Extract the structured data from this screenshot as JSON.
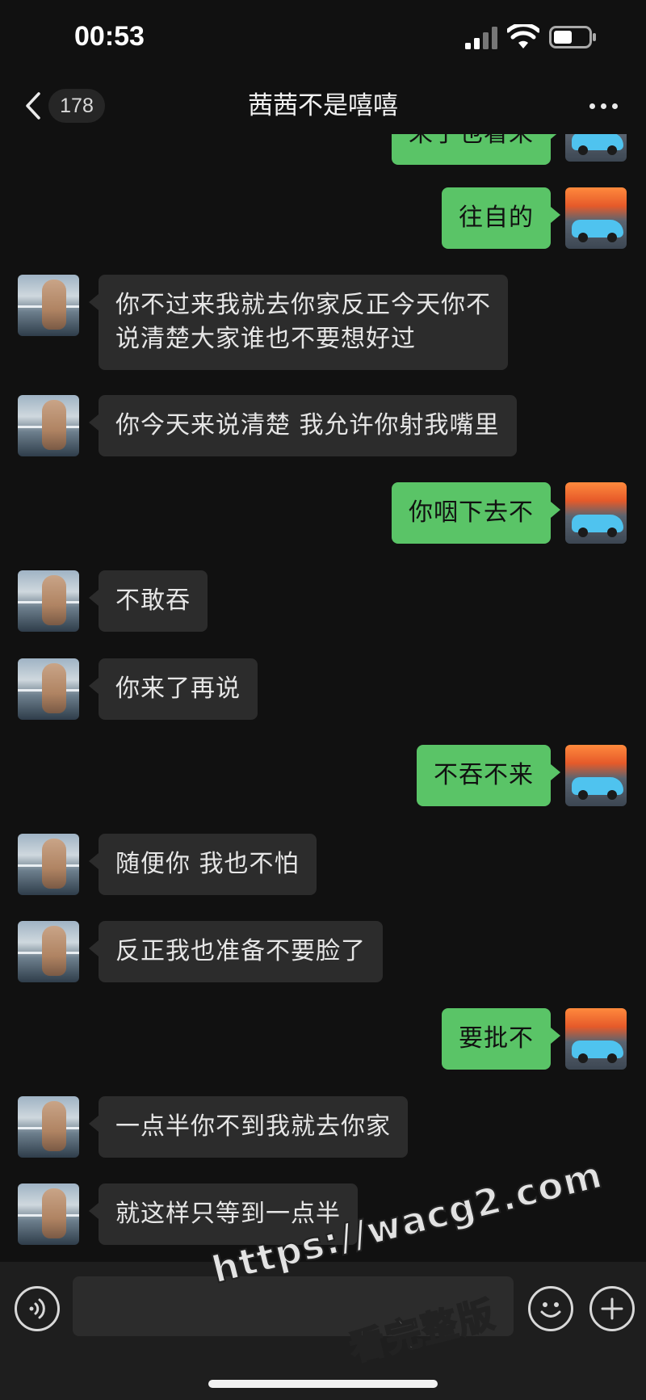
{
  "status_bar": {
    "time": "00:53"
  },
  "nav": {
    "unread_count": "178",
    "title": "茜茜不是嘻嘻"
  },
  "messages": [
    {
      "side": "out",
      "text": "来了也看来"
    },
    {
      "side": "out",
      "text": "往自的"
    },
    {
      "side": "in",
      "text": "你不过来我就去你家反正今天你不\n说清楚大家谁也不要想好过"
    },
    {
      "side": "in",
      "text": "你今天来说清楚 我允许你射我嘴里"
    },
    {
      "side": "out",
      "text": "你咽下去不"
    },
    {
      "side": "in",
      "text": "不敢吞"
    },
    {
      "side": "in",
      "text": "你来了再说"
    },
    {
      "side": "out",
      "text": "不吞不来"
    },
    {
      "side": "in",
      "text": "随便你 我也不怕"
    },
    {
      "side": "in",
      "text": "反正我也准备不要脸了"
    },
    {
      "side": "out",
      "text": "要批不"
    },
    {
      "side": "in",
      "text": "一点半你不到我就去你家"
    },
    {
      "side": "in",
      "text": "就这样只等到一点半"
    }
  ],
  "input_bar": {
    "text_value": ""
  },
  "watermark": {
    "url": "https://wacg2.com",
    "caption": "看完整版"
  },
  "icons": {
    "back": "chevron-left-icon",
    "more": "more-dots-icon",
    "voice": "voice-icon",
    "emoji": "emoji-icon",
    "plus": "plus-icon"
  }
}
